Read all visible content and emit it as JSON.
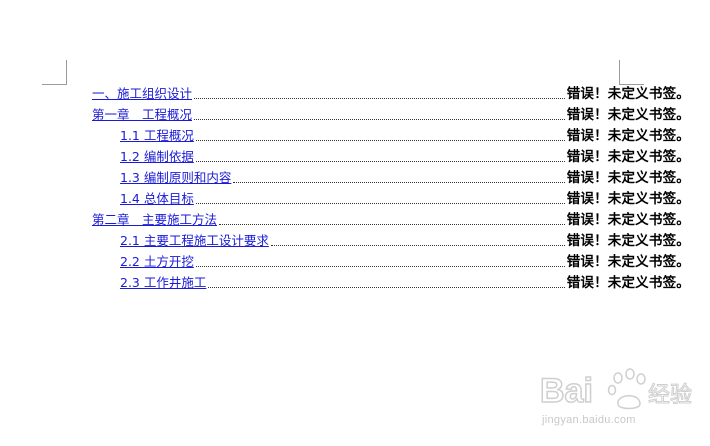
{
  "toc": {
    "entries": [
      {
        "title": "一、施工组织设计",
        "page": "错误！未定义书签。",
        "level": 1
      },
      {
        "title": "第一章　工程概况",
        "page": "错误！未定义书签。",
        "level": 1
      },
      {
        "title": "1.1 工程概况",
        "page": "错误！未定义书签。",
        "level": 2
      },
      {
        "title": "1.2 编制依据",
        "page": "错误！未定义书签。",
        "level": 2
      },
      {
        "title": "1.3 编制原则和内容",
        "page": "错误！未定义书签。",
        "level": 2
      },
      {
        "title": "1.4 总体目标",
        "page": "错误！未定义书签。",
        "level": 2
      },
      {
        "title": "第二章　主要施工方法",
        "page": "错误！未定义书签。",
        "level": 1
      },
      {
        "title": "2.1 主要工程施工设计要求",
        "page": "错误！未定义书签。",
        "level": 2
      },
      {
        "title": "2.2 土方开挖",
        "page": "错误！未定义书签。",
        "level": 2
      },
      {
        "title": "2.3 工作井施工",
        "page": "错误！未定义书签。",
        "level": 2
      }
    ]
  },
  "watermark": {
    "logo_text": "Bai",
    "logo_text_cn": "经验",
    "url": "jingyan.baidu.com"
  },
  "colors": {
    "link": "#1a1ad9",
    "page_text": "#000000",
    "watermark": "#d0d0d0"
  }
}
